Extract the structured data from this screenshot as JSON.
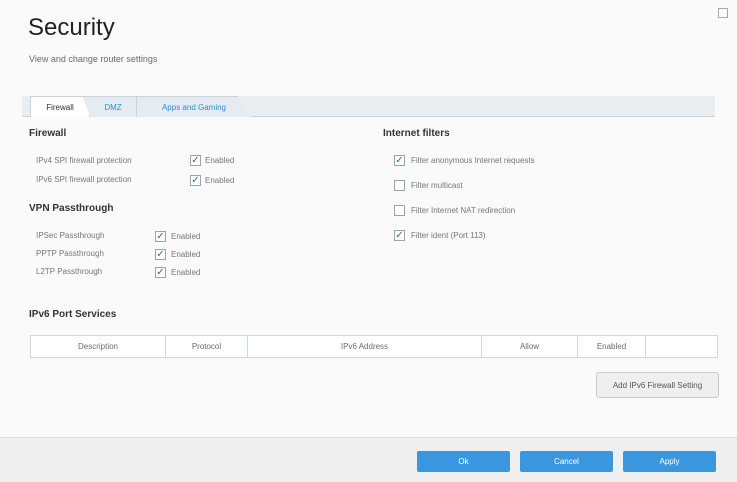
{
  "header": {
    "title": "Security",
    "subtitle": "View and change router settings"
  },
  "tabs": [
    {
      "label": "Firewall"
    },
    {
      "label": "DMZ"
    },
    {
      "label": "Apps and Gaming"
    }
  ],
  "firewall": {
    "title": "Firewall",
    "rows": [
      {
        "label": "IPv4 SPI firewall protection",
        "status": "Enabled",
        "checked": true
      },
      {
        "label": "IPv6 SPI firewall protection",
        "status": "Enabled",
        "checked": true
      }
    ]
  },
  "vpn": {
    "title": "VPN Passthrough",
    "rows": [
      {
        "label": "IPSec Passthrough",
        "status": "Enabled",
        "checked": true
      },
      {
        "label": "PPTP Passthrough",
        "status": "Enabled",
        "checked": true
      },
      {
        "label": "L2TP Passthrough",
        "status": "Enabled",
        "checked": true
      }
    ]
  },
  "filters": {
    "title": "Internet filters",
    "items": [
      {
        "label": "Filter anonymous Internet requests",
        "checked": true
      },
      {
        "label": "Filter multicast",
        "checked": false
      },
      {
        "label": "Filter Internet NAT redirection",
        "checked": false
      },
      {
        "label": "Filter ident (Port 113)",
        "checked": true
      }
    ]
  },
  "ipv6": {
    "title": "IPv6 Port Services",
    "columns": [
      "Description",
      "Protocol",
      "IPv6 Address",
      "Allow",
      "Enabled",
      ""
    ],
    "add_button": "Add IPv6 Firewall Setting"
  },
  "footer": {
    "ok": "Ok",
    "cancel": "Cancel",
    "apply": "Apply"
  },
  "colors": {
    "accent": "#3a97df",
    "tab_text": "#2e8ccf"
  }
}
